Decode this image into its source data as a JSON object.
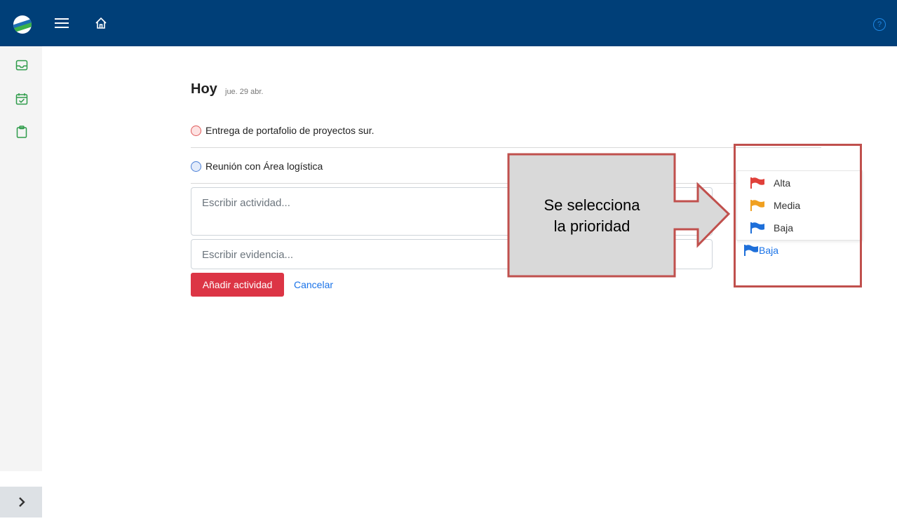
{
  "header": {
    "menu_icon": "hamburger-icon",
    "home_icon": "home-icon",
    "help_icon": "question-circle-icon",
    "help_glyph": "?"
  },
  "sidebar": {
    "items": [
      {
        "icon": "inbox-icon"
      },
      {
        "icon": "calendar-check-icon"
      },
      {
        "icon": "clipboard-icon"
      }
    ],
    "collapse_glyph": "›"
  },
  "main": {
    "title": "Hoy",
    "date": "jue. 29 abr.",
    "tasks": [
      {
        "label": "Entrega de portafolio de proyectos sur.",
        "priority_color": "#e05a5a"
      },
      {
        "label": "Reunión con Área logística",
        "priority_color": "#4a7fd6"
      }
    ],
    "activity_placeholder": "Escribir actividad...",
    "evidence_placeholder": "Escribir evidencia...",
    "add_button": "Añadir actividad",
    "cancel_button": "Cancelar"
  },
  "priority_menu": {
    "options": [
      {
        "label": "Alta",
        "color": "#e0403a"
      },
      {
        "label": "Media",
        "color": "#f0a020"
      },
      {
        "label": "Baja",
        "color": "#1e6fd9"
      }
    ],
    "selected": {
      "label": "Baja",
      "color": "#1e6fd9"
    }
  },
  "callout": {
    "line1": "Se selecciona",
    "line2": "la prioridad"
  },
  "colors": {
    "topbar": "#003f78",
    "accent_red": "#dc3545",
    "link_blue": "#1a73e8",
    "annotation_border": "#c0504d"
  }
}
